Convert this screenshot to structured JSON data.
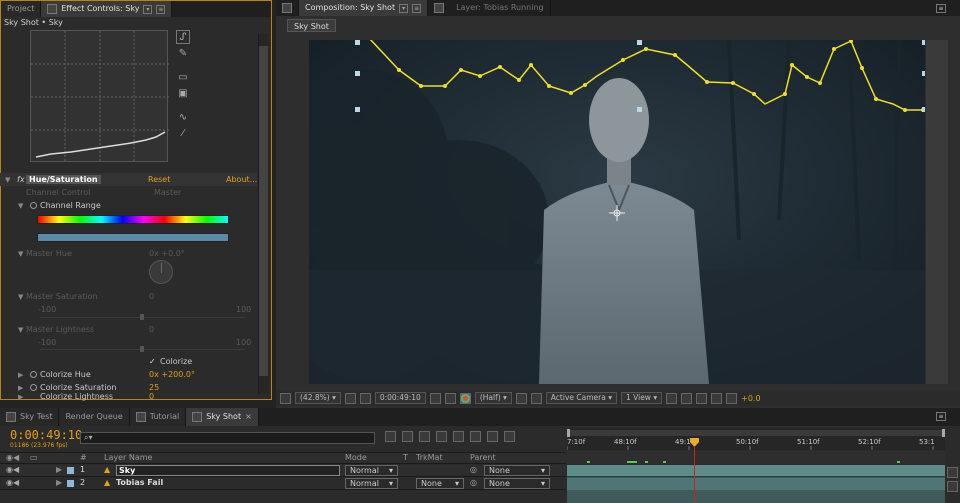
{
  "left_panel": {
    "tabs": [
      {
        "label": "Project",
        "active": false
      },
      {
        "label": "Effect Controls: Sky",
        "active": true
      }
    ],
    "header": "Sky Shot • Sky",
    "effect": {
      "name": "Hue/Saturation",
      "fx": "fx",
      "reset": "Reset",
      "about": "About...",
      "channel_control_label": "Channel Control",
      "channel_control_value": "Master",
      "channel_range_label": "Channel Range",
      "master_hue_label": "Master Hue",
      "master_hue_value": "0x +0.0°",
      "master_saturation_label": "Master Saturation",
      "master_saturation_value": "0",
      "master_saturation_min": "-100",
      "master_saturation_max": "100",
      "master_lightness_label": "Master Lightness",
      "master_lightness_value": "0",
      "master_lightness_min": "-100",
      "master_lightness_max": "100",
      "colorize_label": "Colorize",
      "colorize_checked": true,
      "colorize_hue_label": "Colorize Hue",
      "colorize_hue_value": "0x +200.0°",
      "colorize_saturation_label": "Colorize Saturation",
      "colorize_saturation_value": "25",
      "colorize_lightness_label": "Colorize Lightness",
      "colorize_lightness_value": "0"
    }
  },
  "comp_panel": {
    "tabs": [
      {
        "label": "Composition: Sky Shot",
        "active": true
      },
      {
        "label": "Layer: Tobias Running",
        "active": false
      }
    ],
    "subtab": "Sky Shot",
    "viewer_bar": {
      "zoom": "(42.8%)",
      "timecode": "0:00:49:10",
      "resolution": "(Half)",
      "camera": "Active Camera",
      "views": "1 View",
      "exposure": "+0.0"
    }
  },
  "timeline": {
    "tabs": [
      {
        "label": "Sky Test",
        "active": false
      },
      {
        "label": "Render Queue",
        "active": false
      },
      {
        "label": "Tutorial",
        "active": false
      },
      {
        "label": "Sky Shot",
        "active": true
      }
    ],
    "timecode": "0:00:49:10",
    "frames": "01186 (23.976 fps)",
    "search_placeholder": "",
    "columns": {
      "hash": "#",
      "layer_name": "Layer Name",
      "mode": "Mode",
      "t": "T",
      "trkmat": "TrkMat",
      "parent": "Parent"
    },
    "ruler_labels": [
      "7:10f",
      "48:10f",
      "49:10f",
      "50:10f",
      "51:10f",
      "52:10f",
      "53:1"
    ],
    "layers": [
      {
        "num": "1",
        "name": "Sky",
        "mode": "Normal",
        "trkmat": "",
        "parent": "None",
        "color": "#8fb8d8"
      },
      {
        "num": "2",
        "name": "Tobias Fail",
        "mode": "Normal",
        "trkmat": "None",
        "parent": "None",
        "color": "#8fb8d8"
      }
    ]
  },
  "colors": {
    "accent": "#e8a010",
    "panel_border": "#b8860b",
    "curve_line": "#f0e020",
    "cti": "#d02020",
    "track": "#3f5a58"
  }
}
